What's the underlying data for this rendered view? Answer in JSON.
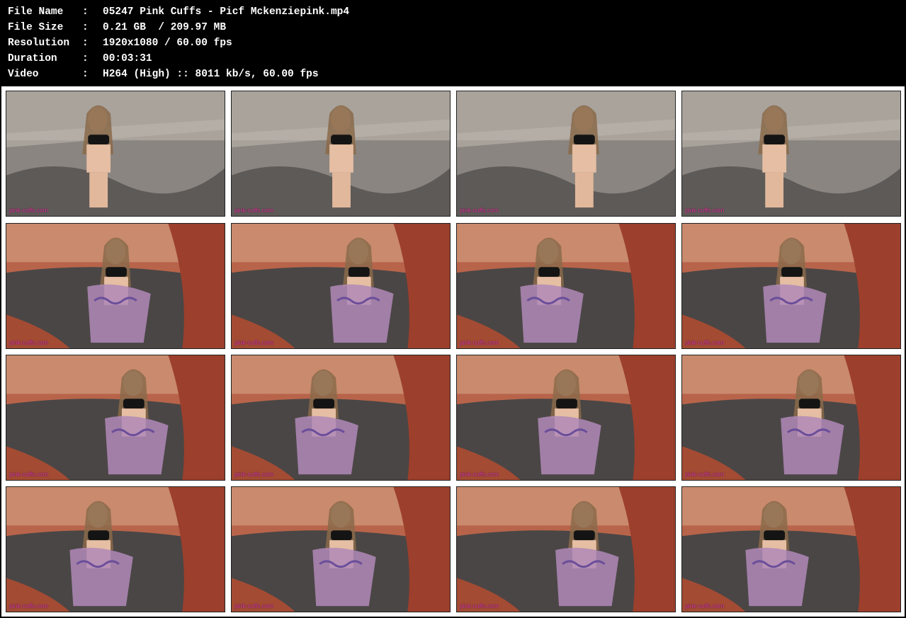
{
  "header": {
    "rows": [
      {
        "label": "File Name",
        "sep": ":",
        "value": "05247 Pink Cuffs - Picf Mckenziepink.mp4"
      },
      {
        "label": "File Size",
        "sep": ":",
        "value": "0.21 GB  / 209.97 MB"
      },
      {
        "label": "Resolution",
        "sep": ":",
        "value": "1920x1080 / 60.00 fps"
      },
      {
        "label": "Duration",
        "sep": ":",
        "value": "00:03:31"
      },
      {
        "label": "Video",
        "sep": ":",
        "value": "H264 (High) :: 8011 kb/s, 60.00 fps"
      }
    ]
  },
  "thumbnails": {
    "watermark": "pink-cuffs.com",
    "items": [
      {
        "scene": "grey-rock-seated"
      },
      {
        "scene": "grey-rock-seated-close"
      },
      {
        "scene": "grey-rock-standing"
      },
      {
        "scene": "grey-rock-walking"
      },
      {
        "scene": "red-rock-seated"
      },
      {
        "scene": "red-rock-hands-closeup"
      },
      {
        "scene": "red-rock-seated-wide"
      },
      {
        "scene": "red-rock-wall-closeup"
      },
      {
        "scene": "red-rock-cuffs-closeup"
      },
      {
        "scene": "red-rock-seated-tree"
      },
      {
        "scene": "red-rock-seated-tree-2"
      },
      {
        "scene": "red-rock-seated-tree-3"
      },
      {
        "scene": "red-rock-cave-wide"
      },
      {
        "scene": "red-rock-seated-face"
      },
      {
        "scene": "red-rock-torso-closeup"
      },
      {
        "scene": "red-rock-seated-right"
      }
    ]
  },
  "colors": {
    "background": "#000000",
    "sheet": "#ffffff",
    "text": "#ffffff",
    "watermark": "#e040a0"
  }
}
